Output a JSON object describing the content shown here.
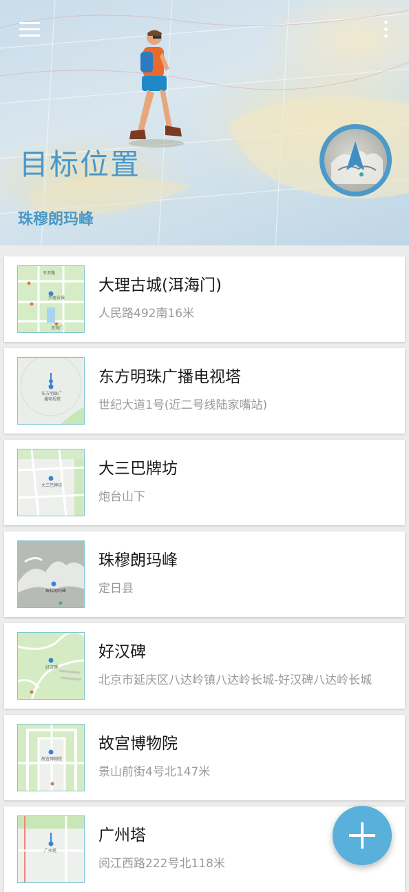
{
  "header": {
    "title": "目标位置",
    "subtitle": "珠穆朗玛峰",
    "menu_icon": "hamburger-menu-icon",
    "more_icon": "more-vertical-icon",
    "compass_label": "珠穆朗玛峰",
    "accent_color": "#4a98c8"
  },
  "locations": [
    {
      "name": "大理古城(洱海门)",
      "address": "人民路492南16米",
      "thumb_type": "grid-green",
      "thumb_labels": [
        "玉洱路",
        "大理古城",
        "洱海门"
      ]
    },
    {
      "name": "东方明珠广播电视塔",
      "address": "世纪大道1号(近二号线陆家嘴站)",
      "thumb_type": "tower",
      "thumb_labels": [
        "东方明珠广",
        "播电视塔"
      ]
    },
    {
      "name": "大三巴牌坊",
      "address": "炮台山下",
      "thumb_type": "street-grey",
      "thumb_labels": [
        "大三巴牌坊"
      ]
    },
    {
      "name": "珠穆朗玛峰",
      "address": "定日县",
      "thumb_type": "mountain",
      "thumb_labels": [
        "珠穆朗玛峰"
      ]
    },
    {
      "name": "好汉碑",
      "address": "北京市延庆区八达岭镇八达岭长城-好汉碑八达岭长城",
      "thumb_type": "green-roads",
      "thumb_labels": [
        "好汉碑"
      ]
    },
    {
      "name": "故宫博物院",
      "address": "景山前街4号北147米",
      "thumb_type": "palace",
      "thumb_labels": [
        "故宫博物院"
      ]
    },
    {
      "name": "广州塔",
      "address": "阅江西路222号北118米",
      "thumb_type": "tower-grey",
      "thumb_labels": [
        "广州塔"
      ]
    }
  ],
  "fab": {
    "icon": "add-icon",
    "color": "#58b0db"
  }
}
